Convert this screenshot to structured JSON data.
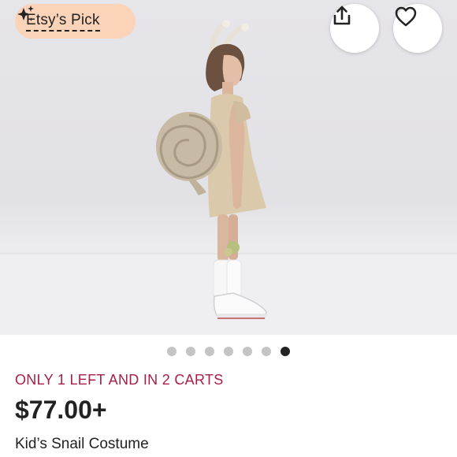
{
  "badge": {
    "label": "Etsy’s Pick",
    "icon": "sparkle-icon"
  },
  "actions": {
    "share_icon": "share-icon",
    "favorite_icon": "heart-icon"
  },
  "carousel": {
    "total": 7,
    "active_index": 6
  },
  "listing": {
    "scarcity": "ONLY 1 LEFT AND IN 2 CARTS",
    "price": "$77.00+",
    "title": "Kid’s Snail Costume"
  },
  "colors": {
    "badge_bg": "#fbd3b8",
    "scarcity_text": "#a51f47",
    "text": "#222222",
    "dot_inactive": "#c4c4c4",
    "dot_active": "#222222"
  }
}
